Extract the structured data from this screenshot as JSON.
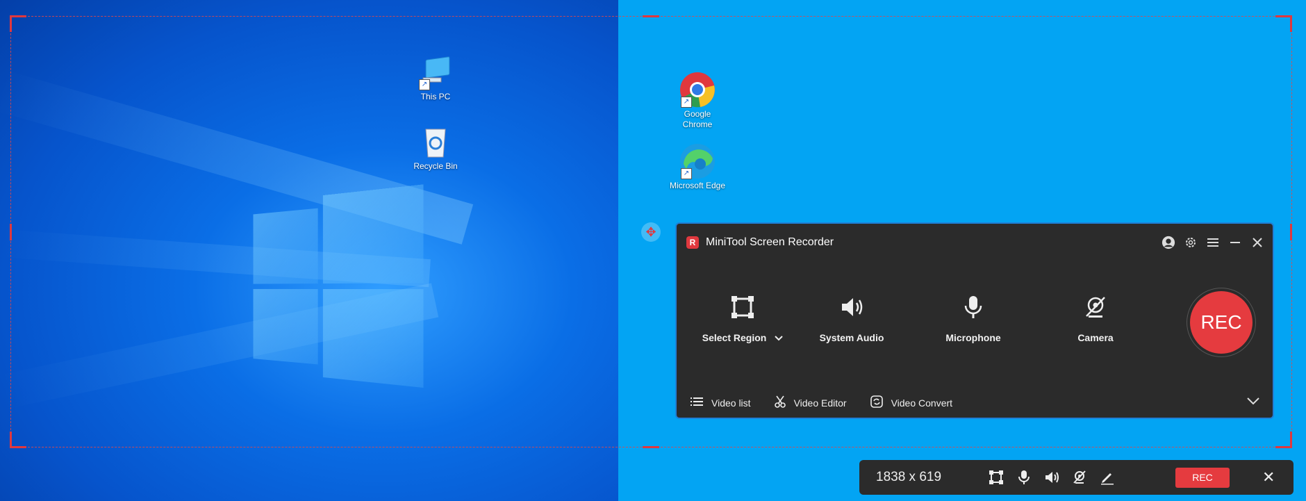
{
  "desktop": {
    "left_icons": [
      {
        "label": "This PC",
        "icon": "this-pc-icon"
      },
      {
        "label": "Recycle Bin",
        "icon": "recycle-bin-icon"
      }
    ],
    "right_icons": [
      {
        "label": "Google Chrome",
        "icon": "chrome-icon"
      },
      {
        "label": "Microsoft Edge",
        "icon": "edge-icon"
      }
    ]
  },
  "recorder": {
    "title": "MiniTool Screen Recorder",
    "logo_letter": "R",
    "tools": [
      {
        "label": "Select Region",
        "icon": "select-region-icon"
      },
      {
        "label": "System Audio",
        "icon": "speaker-icon"
      },
      {
        "label": "Microphone",
        "icon": "microphone-icon"
      },
      {
        "label": "Camera",
        "icon": "camera-off-icon"
      }
    ],
    "rec_label": "REC",
    "links": [
      {
        "label": "Video list",
        "icon": "list-icon"
      },
      {
        "label": "Video Editor",
        "icon": "scissors-icon"
      },
      {
        "label": "Video Convert",
        "icon": "convert-icon"
      }
    ]
  },
  "toolbar": {
    "dimensions": "1838 x 619",
    "rec_label": "REC"
  },
  "colors": {
    "accent_red": "#e53b3f",
    "panel_bg": "#2b2b2b",
    "desktop_right": "#03a4f3"
  }
}
